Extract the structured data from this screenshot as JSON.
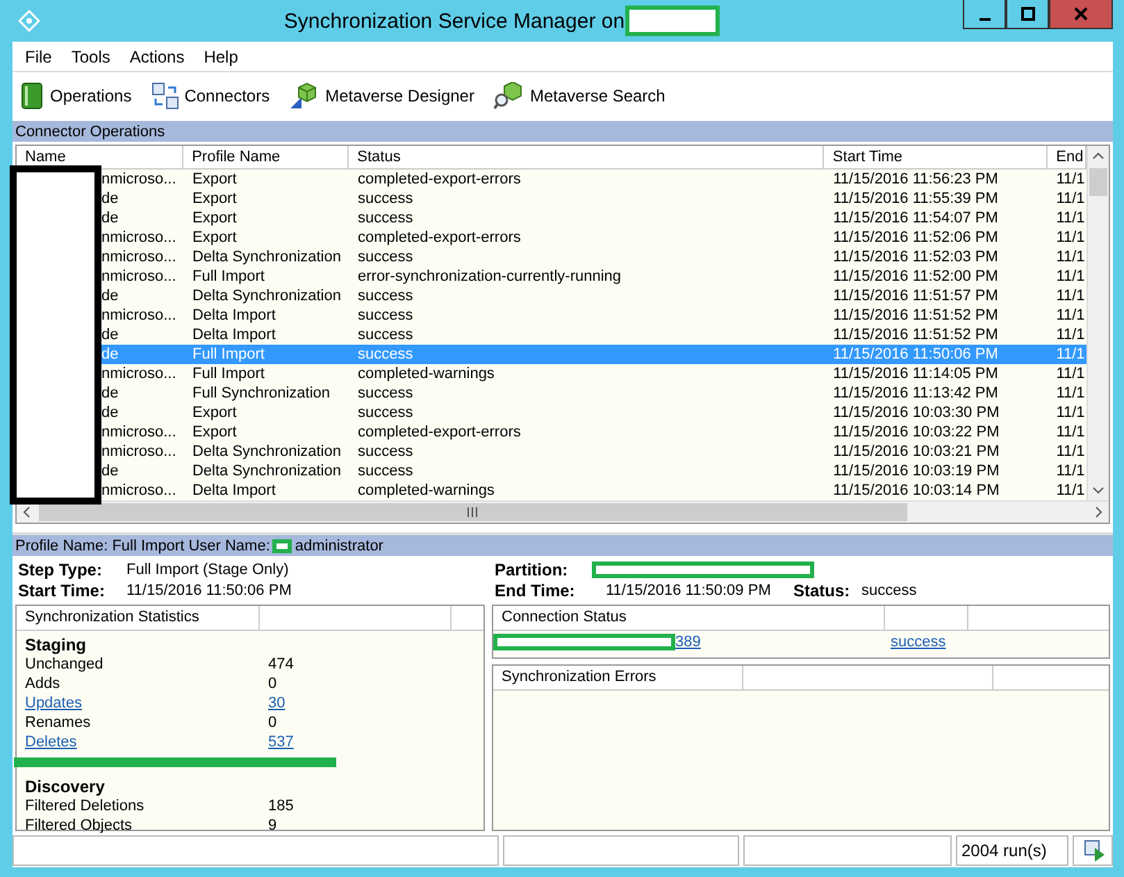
{
  "window": {
    "title": "Synchronization Service Manager on"
  },
  "menu": [
    "File",
    "Tools",
    "Actions",
    "Help"
  ],
  "toolbar": [
    {
      "label": "Operations",
      "kind": "operations"
    },
    {
      "label": "Connectors",
      "kind": "connectors"
    },
    {
      "label": "Metaverse Designer",
      "kind": "designer"
    },
    {
      "label": "Metaverse Search",
      "kind": "search"
    }
  ],
  "operations": {
    "title": "Connector Operations",
    "columns": [
      "Name",
      "Profile Name",
      "Status",
      "Start Time",
      "End"
    ],
    "rows": [
      {
        "name": "nmicroso...",
        "profile": "Export",
        "status": "completed-export-errors",
        "start": "11/15/2016 11:56:23 PM",
        "end": "11/1",
        "selected": false
      },
      {
        "name": "de",
        "profile": "Export",
        "status": "success",
        "start": "11/15/2016 11:55:39 PM",
        "end": "11/1",
        "selected": false
      },
      {
        "name": "de",
        "profile": "Export",
        "status": "success",
        "start": "11/15/2016 11:54:07 PM",
        "end": "11/1",
        "selected": false
      },
      {
        "name": "nmicroso...",
        "profile": "Export",
        "status": "completed-export-errors",
        "start": "11/15/2016 11:52:06 PM",
        "end": "11/1",
        "selected": false
      },
      {
        "name": "nmicroso...",
        "profile": "Delta Synchronization",
        "status": "success",
        "start": "11/15/2016 11:52:03 PM",
        "end": "11/1",
        "selected": false
      },
      {
        "name": "nmicroso...",
        "profile": "Full Import",
        "status": "error-synchronization-currently-running",
        "start": "11/15/2016 11:52:00 PM",
        "end": "11/1",
        "selected": false
      },
      {
        "name": "de",
        "profile": "Delta Synchronization",
        "status": "success",
        "start": "11/15/2016 11:51:57 PM",
        "end": "11/1",
        "selected": false
      },
      {
        "name": "nmicroso...",
        "profile": "Delta Import",
        "status": "success",
        "start": "11/15/2016 11:51:52 PM",
        "end": "11/1",
        "selected": false
      },
      {
        "name": "de",
        "profile": "Delta Import",
        "status": "success",
        "start": "11/15/2016 11:51:52 PM",
        "end": "11/1",
        "selected": false
      },
      {
        "name": "de",
        "profile": "Full Import",
        "status": "success",
        "start": "11/15/2016 11:50:06 PM",
        "end": "11/1",
        "selected": true
      },
      {
        "name": "nmicroso...",
        "profile": "Full Import",
        "status": "completed-warnings",
        "start": "11/15/2016 11:14:05 PM",
        "end": "11/1",
        "selected": false
      },
      {
        "name": "de",
        "profile": "Full Synchronization",
        "status": "success",
        "start": "11/15/2016 11:13:42 PM",
        "end": "11/1",
        "selected": false
      },
      {
        "name": "de",
        "profile": "Export",
        "status": "success",
        "start": "11/15/2016 10:03:30 PM",
        "end": "11/1",
        "selected": false
      },
      {
        "name": "nmicroso...",
        "profile": "Export",
        "status": "completed-export-errors",
        "start": "11/15/2016 10:03:22 PM",
        "end": "11/1",
        "selected": false
      },
      {
        "name": "nmicroso...",
        "profile": "Delta Synchronization",
        "status": "success",
        "start": "11/15/2016 10:03:21 PM",
        "end": "11/1",
        "selected": false
      },
      {
        "name": "de",
        "profile": "Delta Synchronization",
        "status": "success",
        "start": "11/15/2016 10:03:19 PM",
        "end": "11/1",
        "selected": false
      },
      {
        "name": "nmicroso...",
        "profile": "Delta Import",
        "status": "completed-warnings",
        "start": "11/15/2016 10:03:14 PM",
        "end": "11/1",
        "selected": false
      }
    ]
  },
  "details": {
    "profile_label": "Profile Name: Full Import  User Name:",
    "user": "administrator",
    "step_type_label": "Step Type:",
    "step_type": "Full Import (Stage Only)",
    "start_time_label": "Start Time:",
    "start_time": "11/15/2016 11:50:06 PM",
    "partition_label": "Partition:",
    "end_time_label": "End Time:",
    "end_time": "11/15/2016 11:50:09 PM",
    "status_label": "Status:",
    "status": "success"
  },
  "statistics": {
    "title": "Synchronization Statistics",
    "sections": [
      {
        "heading": "Staging",
        "items": [
          {
            "label": "Unchanged",
            "value": "474",
            "link": false
          },
          {
            "label": "Adds",
            "value": "0",
            "link": false
          },
          {
            "label": "Updates",
            "value": "30",
            "link": true
          },
          {
            "label": "Renames",
            "value": "0",
            "link": false
          },
          {
            "label": "Deletes",
            "value": "537",
            "link": true
          }
        ]
      },
      {
        "heading": "Discovery",
        "items": [
          {
            "label": "Filtered Deletions",
            "value": "185",
            "link": false
          },
          {
            "label": "Filtered Objects",
            "value": "9",
            "link": false
          }
        ]
      }
    ]
  },
  "connection_status": {
    "title": "Connection Status",
    "port": "389",
    "result": "success"
  },
  "sync_errors": {
    "title": "Synchronization Errors"
  },
  "status_bar": {
    "runs": "2004 run(s)"
  }
}
